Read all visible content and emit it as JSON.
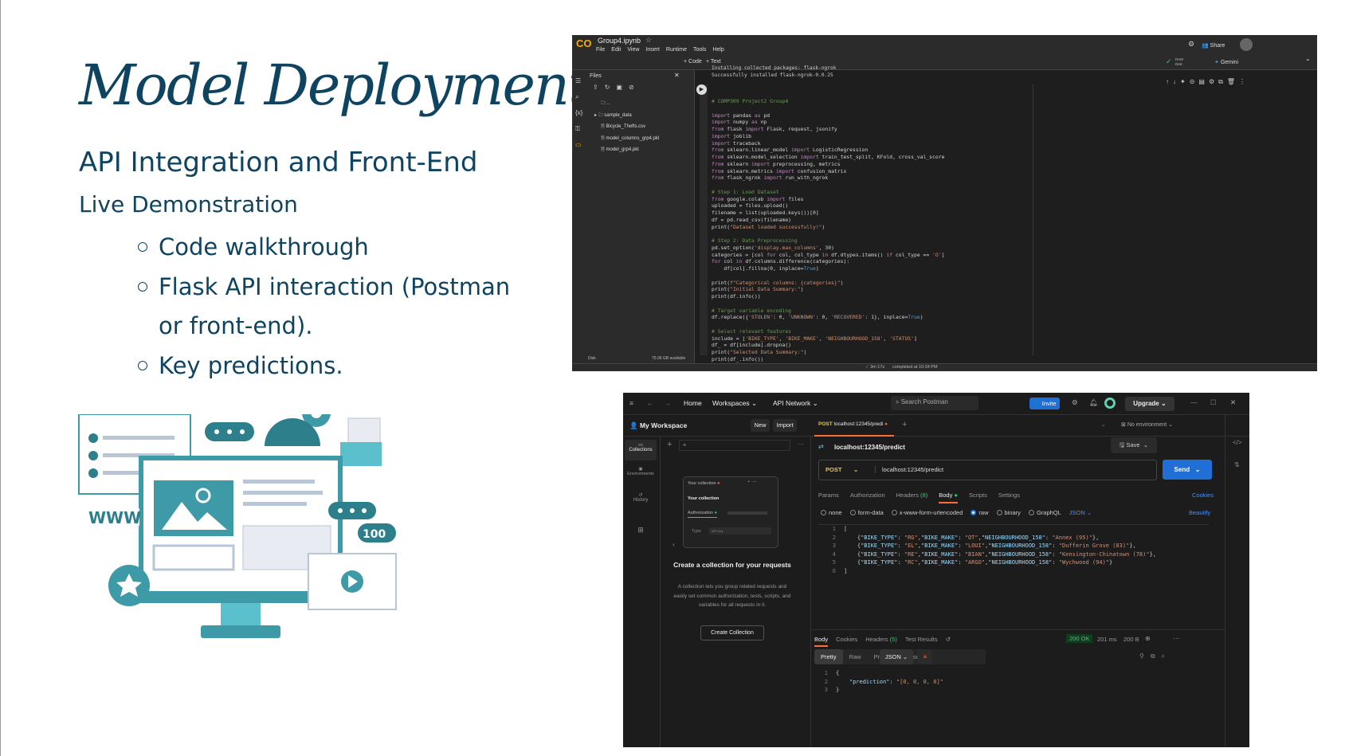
{
  "slide": {
    "title": "Model Deployment",
    "subtitle": "API Integration and Front-End",
    "section": "Live Demonstration",
    "bullets": [
      "Code walkthrough",
      "Flask API interaction (Postman or front-end).",
      "Key predictions."
    ],
    "text_color": "#0f4461"
  },
  "illustration": {
    "www_label": "WWW",
    "likes_label": "100"
  },
  "colab": {
    "filename": "Group4.ipynb",
    "menu": [
      "File",
      "Edit",
      "View",
      "Insert",
      "Runtime",
      "Tools",
      "Help"
    ],
    "share": "Share",
    "add_code": "+ Code",
    "add_text": "+ Text",
    "ram": "RAM",
    "disk": "Disk",
    "gemini": "Gemini",
    "files_title": "Files",
    "files": [
      "..",
      "sample_data",
      "Bicycle_Thefts.csv",
      "model_columns_grp4.pkl",
      "model_grp4.pkl"
    ],
    "disk_label": "Disk",
    "disk_avail": "75.06 GB available",
    "output": [
      "Installing collected packages: flask-ngrok",
      "Successfully installed flask-ngrok-0.0.25"
    ],
    "code": [
      "# COMP309 Project2 Group4",
      "",
      "import pandas as pd",
      "import numpy as np",
      "from flask import Flask, request, jsonify",
      "import joblib",
      "import traceback",
      "from sklearn.linear_model import LogisticRegression",
      "from sklearn.model_selection import train_test_split, KFold, cross_val_score",
      "from sklearn import preprocessing, metrics",
      "from sklearn.metrics import confusion_matrix",
      "from flask_ngrok import run_with_ngrok",
      "",
      "# Step 1: Load Dataset",
      "from google.colab import files",
      "uploaded = files.upload()",
      "filename = list(uploaded.keys())[0]",
      "df = pd.read_csv(filename)",
      "print(\"Dataset loaded successfully!\")",
      "",
      "# Step 2: Data Preprocessing",
      "pd.set_option('display.max_columns', 30)",
      "categories = [col for col, col_type in df.dtypes.items() if col_type == 'O']",
      "for col in df.columns.difference(categories):",
      "    df[col].fillna(0, inplace=True)",
      "",
      "print(f\"Categorical columns: {categories}\")",
      "print(\"Initial Data Summary:\")",
      "print(df.info())",
      "",
      "# Target variable encoding",
      "df.replace({'STOLEN': 0, 'UNKNOWN': 0, 'RECOVERED': 1}, inplace=True)",
      "",
      "# Select relevant features",
      "include = ['BIKE_TYPE', 'BIKE_MAKE', 'NEIGHBOURHOOD_158', 'STATUS']",
      "df_ = df[include].dropna()",
      "print(\"Selected Data Summary:\")",
      "print(df_.info())"
    ],
    "exec_time": "3m 17s",
    "completed": "completed at 10:34 PM"
  },
  "postman": {
    "nav": {
      "home": "Home",
      "workspaces": "Workspaces",
      "api_network": "API Network",
      "search_placeholder": "Search Postman",
      "invite": "Invite",
      "upgrade": "Upgrade"
    },
    "workspace": "My Workspace",
    "new": "New",
    "import": "Import",
    "tab_method": "POST",
    "tab_label": "localhost:12345/predi",
    "no_env": "No environment",
    "rail": [
      "Collections",
      "Environments",
      "History"
    ],
    "collection_preview": {
      "title": "Your collection",
      "heading": "Your collection",
      "auth": "Authorization",
      "type": "Type",
      "type_value": "API Key"
    },
    "empty_title": "Create a collection for your requests",
    "empty_text": "A collection lets you group related requests and easily set common authorization, tests, scripts, and variables for all requests in it.",
    "create_button": "Create Collection",
    "request_name": "localhost:12345/predict",
    "save": "Save",
    "method": "POST",
    "url": "localhost:12345/predict",
    "send": "Send",
    "req_tabs": [
      "Params",
      "Authorization",
      "Headers (8)",
      "Body",
      "Scripts",
      "Settings"
    ],
    "cookies": "Cookies",
    "body_types": [
      "none",
      "form-data",
      "x-www-form-urlencoded",
      "raw",
      "binary",
      "GraphQL"
    ],
    "body_format": "JSON",
    "beautify": "Beautify",
    "request_body": [
      [
        "[",
        ""
      ],
      [
        "    {\"BIKE_TYPE\": \"RG\",\"BIKE_MAKE\": \"OT\",\"NEIGHBOURHOOD_158\": \"Annex (95)\"},",
        ""
      ],
      [
        "    {\"BIKE_TYPE\": \"EL\",\"BIKE_MAKE\": \"LOUI\",\"NEIGHBOURHOOD_158\": \"Dufferin Grove (83)\"},",
        ""
      ],
      [
        "    {\"BIKE_TYPE\": \"RE\",\"BIKE_MAKE\": \"BIAN\",\"NEIGHBOURHOOD_158\": \"Kensington-Chinatown (78)\"},",
        ""
      ],
      [
        "    {\"BIKE_TYPE\": \"RC\",\"BIKE_MAKE\": \"ARGO\",\"NEIGHBOURHOOD_158\": \"Wychwood (94)\"}",
        ""
      ],
      [
        "]",
        ""
      ]
    ],
    "resp_tabs": [
      "Body",
      "Cookies",
      "Headers (5)",
      "Test Results"
    ],
    "status": "200 OK",
    "time": "201 ms",
    "size": "200 B",
    "resp_views": [
      "Pretty",
      "Raw",
      "Preview",
      "Visualize"
    ],
    "resp_format": "JSON",
    "response_body": [
      "{",
      "    \"prediction\": \"[0, 0, 0, 0]\"",
      "}"
    ],
    "accent": "#1f6fd6",
    "orange": "#ff6c37"
  }
}
